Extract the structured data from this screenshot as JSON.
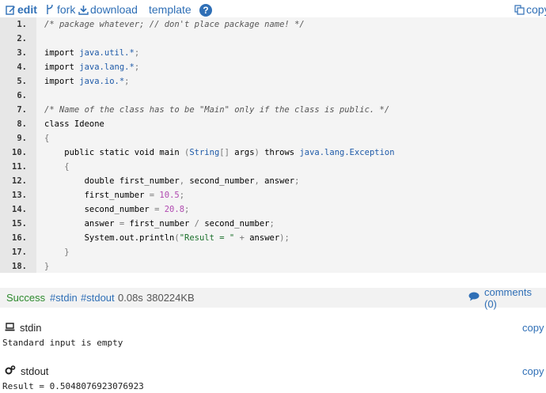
{
  "toolbar": {
    "edit": "edit",
    "fork": "fork",
    "download": "download",
    "template": "template",
    "help": "?",
    "copy": "copy"
  },
  "code": {
    "lines": [
      {
        "n": "1.",
        "t": "/* package whatever; // don't place package name! */"
      },
      {
        "n": "2.",
        "t": ""
      },
      {
        "n": "3.",
        "t": "import java.util.*;"
      },
      {
        "n": "4.",
        "t": "import java.lang.*;"
      },
      {
        "n": "5.",
        "t": "import java.io.*;"
      },
      {
        "n": "6.",
        "t": ""
      },
      {
        "n": "7.",
        "t": "/* Name of the class has to be \"Main\" only if the class is public. */"
      },
      {
        "n": "8.",
        "t": "class Ideone"
      },
      {
        "n": "9.",
        "t": "{"
      },
      {
        "n": "10.",
        "t": "    public static void main (String[] args) throws java.lang.Exception"
      },
      {
        "n": "11.",
        "t": "    {"
      },
      {
        "n": "12.",
        "t": "        double first_number, second_number, answer;"
      },
      {
        "n": "13.",
        "t": "        first_number = 10.5;"
      },
      {
        "n": "14.",
        "t": "        second_number = 20.8;"
      },
      {
        "n": "15.",
        "t": "        answer = first_number / second_number;"
      },
      {
        "n": "16.",
        "t": "        System.out.println(\"Result = \" + answer);"
      },
      {
        "n": "17.",
        "t": "    }"
      },
      {
        "n": "18.",
        "t": "}"
      }
    ]
  },
  "status": {
    "result": "Success",
    "stdin_link": "#stdin",
    "stdout_link": "#stdout",
    "time": "0.08s",
    "memory": "380224KB",
    "comments": "comments (0)"
  },
  "stdin": {
    "label": "stdin",
    "copy": "copy",
    "content": "Standard input is empty"
  },
  "stdout": {
    "label": "stdout",
    "copy": "copy",
    "content": "Result = 0.5048076923076923"
  },
  "colors": {
    "link": "#2f6fb6",
    "success": "#2d8a2d",
    "code_bg": "#f4f4f4",
    "gutter_bg": "#e7e7e7"
  }
}
